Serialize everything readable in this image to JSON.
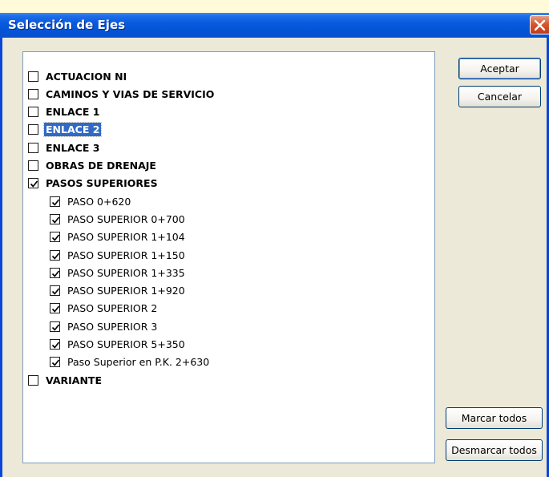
{
  "window": {
    "title": "Selección de Ejes"
  },
  "list": {
    "items": [
      {
        "label": "ACTUACION NI",
        "checked": false,
        "level": 0
      },
      {
        "label": "CAMINOS Y VIAS DE SERVICIO",
        "checked": false,
        "level": 0
      },
      {
        "label": "ENLACE 1",
        "checked": false,
        "level": 0
      },
      {
        "label": "ENLACE 2",
        "checked": false,
        "level": 0,
        "selected": true
      },
      {
        "label": "ENLACE 3",
        "checked": false,
        "level": 0
      },
      {
        "label": "OBRAS DE DRENAJE",
        "checked": false,
        "level": 0
      },
      {
        "label": "PASOS SUPERIORES",
        "checked": true,
        "level": 0
      },
      {
        "label": "PASO 0+620",
        "checked": true,
        "level": 1
      },
      {
        "label": "PASO SUPERIOR 0+700",
        "checked": true,
        "level": 1
      },
      {
        "label": "PASO SUPERIOR 1+104",
        "checked": true,
        "level": 1
      },
      {
        "label": "PASO SUPERIOR 1+150",
        "checked": true,
        "level": 1
      },
      {
        "label": "PASO SUPERIOR 1+335",
        "checked": true,
        "level": 1
      },
      {
        "label": "PASO SUPERIOR 1+920",
        "checked": true,
        "level": 1
      },
      {
        "label": "PASO SUPERIOR 2",
        "checked": true,
        "level": 1
      },
      {
        "label": "PASO SUPERIOR 3",
        "checked": true,
        "level": 1
      },
      {
        "label": "PASO SUPERIOR 5+350",
        "checked": true,
        "level": 1
      },
      {
        "label": "Paso Superior en P.K. 2+630",
        "checked": true,
        "level": 1
      },
      {
        "label": "VARIANTE",
        "checked": false,
        "level": 0
      }
    ]
  },
  "buttons": {
    "accept": "Aceptar",
    "cancel": "Cancelar",
    "check_all": "Marcar todos",
    "uncheck_all": "Desmarcar todos"
  },
  "colors": {
    "titlebar": "#0454d6",
    "selection": "#316ac5",
    "face": "#ece9d8"
  }
}
